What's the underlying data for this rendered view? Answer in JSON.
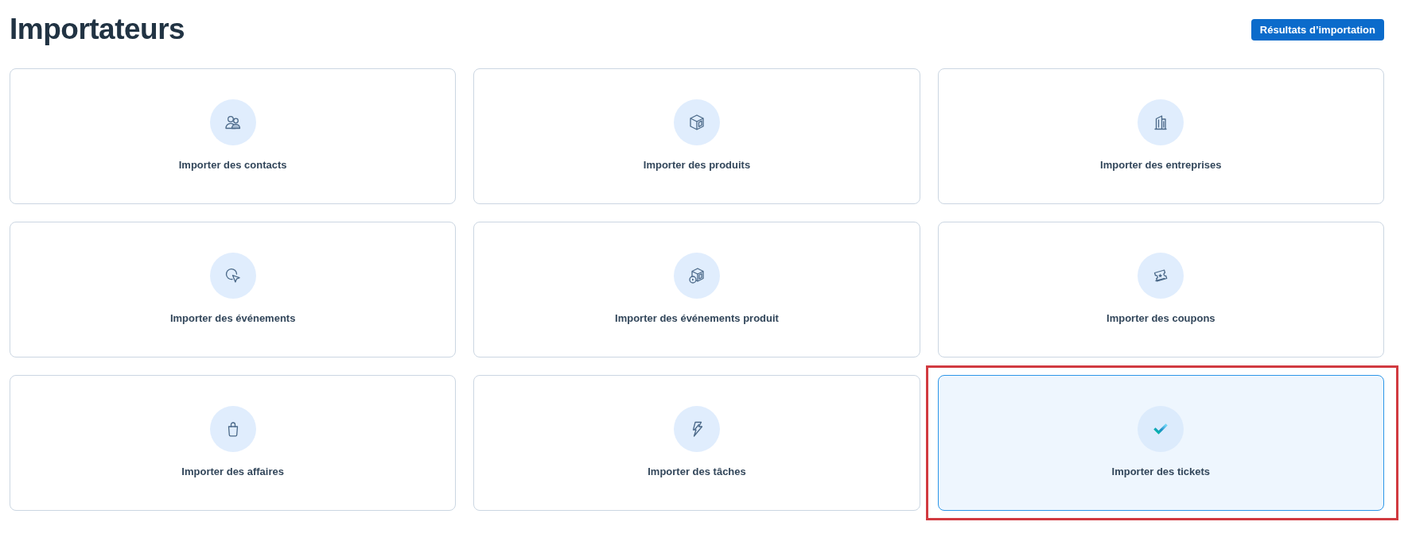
{
  "page": {
    "title": "Importateurs"
  },
  "header_button": {
    "label": "Résultats d’importation"
  },
  "importers": [
    {
      "label": "Importer des contacts",
      "selected": false,
      "highlighted": false
    },
    {
      "label": "Importer des produits",
      "selected": false,
      "highlighted": false
    },
    {
      "label": "Importer des entreprises",
      "selected": false,
      "highlighted": false
    },
    {
      "label": "Importer des événements",
      "selected": false,
      "highlighted": false
    },
    {
      "label": "Importer des événements produit",
      "selected": false,
      "highlighted": false
    },
    {
      "label": "Importer des coupons",
      "selected": false,
      "highlighted": false
    },
    {
      "label": "Importer des affaires",
      "selected": false,
      "highlighted": false
    },
    {
      "label": "Importer des tâches",
      "selected": false,
      "highlighted": false
    },
    {
      "label": "Importer des tickets",
      "selected": true,
      "highlighted": true
    }
  ]
}
